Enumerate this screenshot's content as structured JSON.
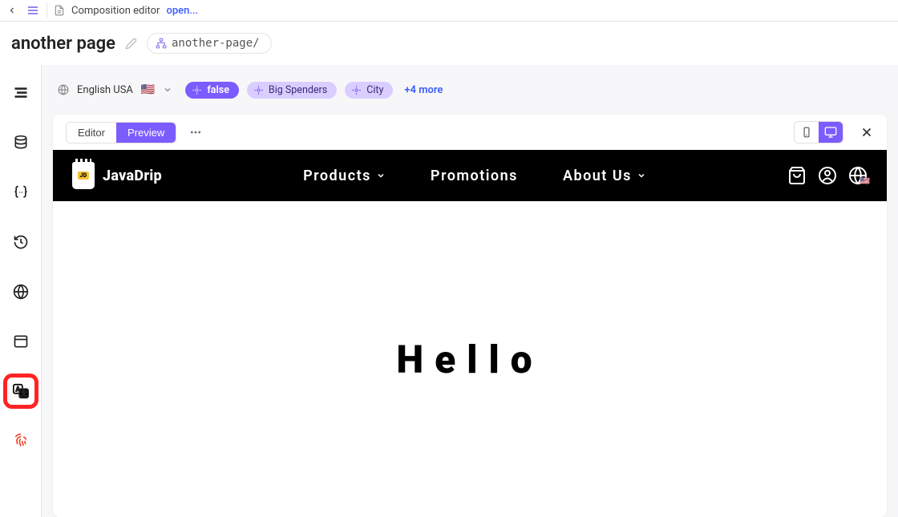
{
  "topbar": {
    "breadcrumb_label": "Composition editor",
    "breadcrumb_action": "open..."
  },
  "titlebar": {
    "page_title": "another page",
    "slug": "another-page/"
  },
  "rail": {
    "items": [
      {
        "name": "structure-icon"
      },
      {
        "name": "data-icon"
      },
      {
        "name": "parameters-icon"
      },
      {
        "name": "history-icon"
      },
      {
        "name": "globe-icon"
      },
      {
        "name": "page-icon"
      },
      {
        "name": "localization-icon",
        "highlighted": true
      },
      {
        "name": "personalization-icon",
        "red": true
      }
    ]
  },
  "context": {
    "locale_label": "English USA",
    "locale_flag": "🇺🇸",
    "chips": [
      {
        "label": "false",
        "variant": "false"
      },
      {
        "label": "Big Spenders",
        "variant": "light"
      },
      {
        "label": "City",
        "variant": "light"
      }
    ],
    "more_label": "+4 more"
  },
  "panel": {
    "toggle": {
      "editor_label": "Editor",
      "preview_label": "Preview",
      "active": "preview"
    }
  },
  "site": {
    "brand_name": "JavaDrip",
    "brand_badge": "JD",
    "menu": [
      {
        "label": "Products",
        "has_caret": true
      },
      {
        "label": "Promotions",
        "has_caret": false
      },
      {
        "label": "About Us",
        "has_caret": true
      }
    ],
    "hero_text": "Hello"
  }
}
